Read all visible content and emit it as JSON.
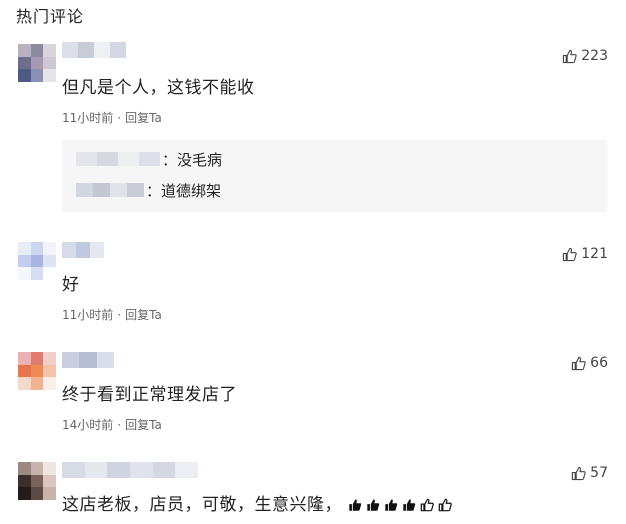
{
  "section": {
    "title": "热门评论"
  },
  "comments": [
    {
      "likes": "223",
      "text": "但凡是个人，这钱不能收",
      "time": "11小时前",
      "separator": "·",
      "reply_label": "回复Ta",
      "replies": [
        {
          "text": "：没毛病"
        },
        {
          "text": "：道德绑架"
        }
      ]
    },
    {
      "likes": "121",
      "text": "好",
      "time": "11小时前",
      "separator": "·",
      "reply_label": "回复Ta"
    },
    {
      "likes": "66",
      "text": "终于看到正常理发店了",
      "time": "14小时前",
      "separator": "·",
      "reply_label": "回复Ta"
    },
    {
      "likes": "57",
      "text": "这店老板，店员，可敬，生意兴隆，",
      "emoji_icons": [
        "thumbs-up-icon",
        "thumbs-up-icon",
        "thumbs-up-icon",
        "thumbs-up-icon",
        "thumbs-up-outline-icon",
        "thumbs-up-outline-icon"
      ]
    }
  ]
}
